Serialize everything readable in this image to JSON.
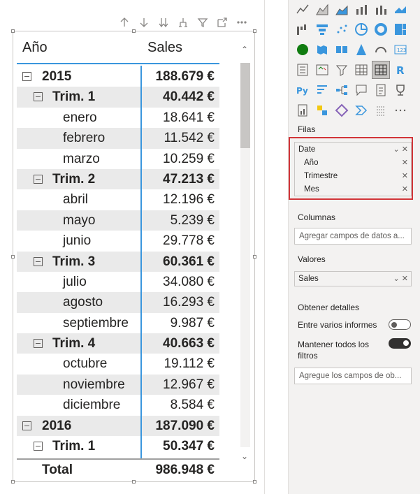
{
  "matrix": {
    "col_row_header": "Año",
    "col_values_header": "Sales",
    "rows": [
      {
        "label": "2015",
        "value": "188.679 €"
      },
      {
        "label": "Trim. 1",
        "value": "40.442 €"
      },
      {
        "label": "enero",
        "value": "18.641 €"
      },
      {
        "label": "febrero",
        "value": "11.542 €"
      },
      {
        "label": "marzo",
        "value": "10.259 €"
      },
      {
        "label": "Trim. 2",
        "value": "47.213 €"
      },
      {
        "label": "abril",
        "value": "12.196 €"
      },
      {
        "label": "mayo",
        "value": "5.239 €"
      },
      {
        "label": "junio",
        "value": "29.778 €"
      },
      {
        "label": "Trim. 3",
        "value": "60.361 €"
      },
      {
        "label": "julio",
        "value": "34.080 €"
      },
      {
        "label": "agosto",
        "value": "16.293 €"
      },
      {
        "label": "septiembre",
        "value": "9.987 €"
      },
      {
        "label": "Trim. 4",
        "value": "40.663 €"
      },
      {
        "label": "octubre",
        "value": "19.112 €"
      },
      {
        "label": "noviembre",
        "value": "12.967 €"
      },
      {
        "label": "diciembre",
        "value": "8.584 €"
      },
      {
        "label": "2016",
        "value": "187.090 €"
      },
      {
        "label": "Trim. 1",
        "value": "50.347 €"
      }
    ],
    "total": {
      "label": "Total",
      "value": "986.948 €"
    }
  },
  "visual_header_icons": [
    "arrow-up-icon",
    "arrow-down-icon",
    "double-arrow-down-icon",
    "expand-hierarchy-icon",
    "filter-icon",
    "focus-mode-icon",
    "more-options-icon"
  ],
  "fields": {
    "filas_label": "Filas",
    "filas_field": "Date",
    "filas_subfields": [
      "Año",
      "Trimestre",
      "Mes"
    ],
    "columnas_label": "Columnas",
    "columnas_placeholder": "Agregar campos de datos a...",
    "valores_label": "Valores",
    "valores_field": "Sales",
    "drillthrough_label": "Obtener detalles",
    "cross_report_label": "Entre varios informes",
    "cross_report_state": "off",
    "keep_filters_label": "Mantener todos los filtros",
    "keep_filters_state": "on",
    "drillthrough_placeholder": "Agregue los campos de ob..."
  },
  "colors": {
    "accent": "#3a96dd",
    "highlight_box": "#d13438",
    "row_shade": "#eaeaea"
  }
}
